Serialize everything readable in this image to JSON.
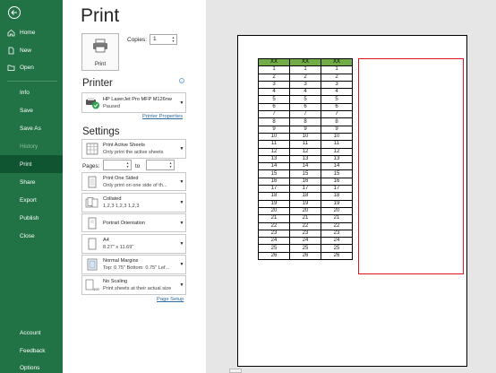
{
  "nav": {
    "items": [
      {
        "label": "Home",
        "icon": "home-icon"
      },
      {
        "label": "New",
        "icon": "new-file-icon"
      },
      {
        "label": "Open",
        "icon": "folder-open-icon"
      },
      {
        "label": "Info"
      },
      {
        "label": "Save"
      },
      {
        "label": "Save As"
      },
      {
        "label": "History"
      },
      {
        "label": "Print"
      },
      {
        "label": "Share"
      },
      {
        "label": "Export"
      },
      {
        "label": "Publish"
      },
      {
        "label": "Close"
      },
      {
        "label": "Account"
      },
      {
        "label": "Feedback"
      },
      {
        "label": "Options"
      }
    ]
  },
  "print": {
    "title": "Print",
    "button_label": "Print",
    "copies_label": "Copies:",
    "copies_value": "1"
  },
  "printer": {
    "heading": "Printer",
    "name": "HP LaserJet Pro MFP M126nw",
    "status": "Paused",
    "properties_link": "Printer Properties"
  },
  "settings": {
    "heading": "Settings",
    "what": {
      "l1": "Print Active Sheets",
      "l2": "Only print the active sheets"
    },
    "pages_label": "Pages:",
    "to_label": "to",
    "sides": {
      "l1": "Print One Sided",
      "l2": "Only print on one side of th..."
    },
    "collate": {
      "l1": "Collated",
      "l2": "1,2,3    1,2,3    1,2,3"
    },
    "orientation": {
      "l1": "Portrait Orientation"
    },
    "paper": {
      "l1": "A4",
      "l2": "8.27\" x 11.69\""
    },
    "margins": {
      "l1": "Normal Margins",
      "l2": "Top: 0.75\" Bottom: 0.75\" Lef..."
    },
    "scaling": {
      "l1": "No Scaling",
      "l2": "Print sheets at their actual size"
    },
    "page_setup_link": "Page Setup"
  },
  "preview": {
    "headers": [
      "XX",
      "XX",
      "XX"
    ],
    "rows": [
      [
        "1",
        "1",
        "1"
      ],
      [
        "2",
        "2",
        "2"
      ],
      [
        "3",
        "3",
        "3"
      ],
      [
        "4",
        "4",
        "4"
      ],
      [
        "5",
        "5",
        "5"
      ],
      [
        "6",
        "6",
        "6"
      ],
      [
        "7",
        "7",
        "7"
      ],
      [
        "8",
        "8",
        "8"
      ],
      [
        "9",
        "9",
        "9"
      ],
      [
        "10",
        "10",
        "10"
      ],
      [
        "11",
        "11",
        "11"
      ],
      [
        "12",
        "12",
        "12"
      ],
      [
        "13",
        "13",
        "13"
      ],
      [
        "14",
        "14",
        "14"
      ],
      [
        "15",
        "15",
        "15"
      ],
      [
        "16",
        "16",
        "16"
      ],
      [
        "17",
        "17",
        "17"
      ],
      [
        "18",
        "18",
        "18"
      ],
      [
        "19",
        "19",
        "19"
      ],
      [
        "20",
        "20",
        "20"
      ],
      [
        "21",
        "21",
        "21"
      ],
      [
        "22",
        "22",
        "22"
      ],
      [
        "23",
        "23",
        "23"
      ],
      [
        "24",
        "24",
        "24"
      ],
      [
        "25",
        "25",
        "25"
      ],
      [
        "26",
        "26",
        "26"
      ]
    ],
    "header_color": "#70ad47",
    "box_color": "#e0141e"
  },
  "colors": {
    "accent": "#217346",
    "active_nav": "#0f5532"
  }
}
